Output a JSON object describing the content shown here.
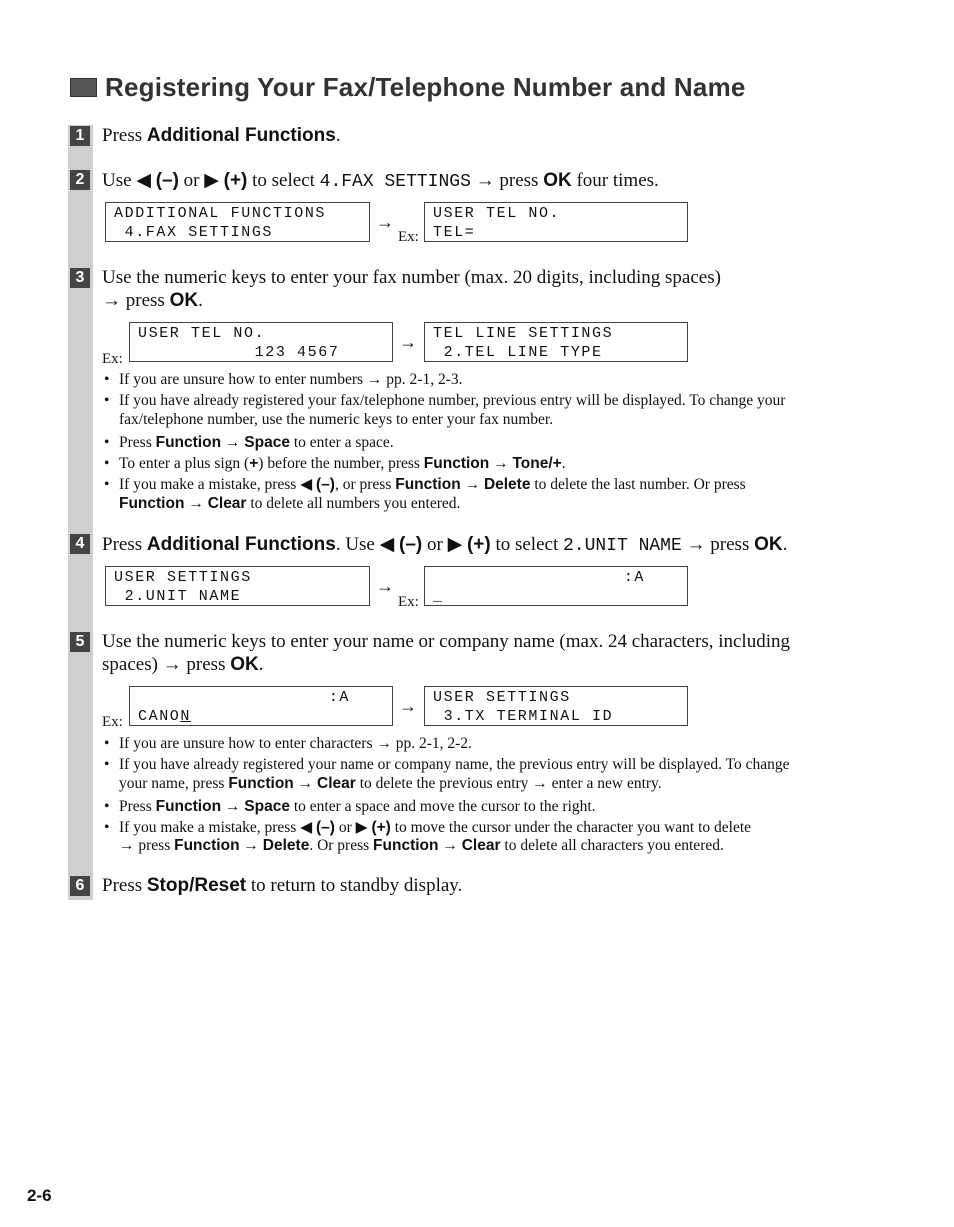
{
  "title": "Registering Your Fax/Telephone Number and Name",
  "page_number": "2-6",
  "symbols": {
    "arrow": "→",
    "left": "◀",
    "right": "▶",
    "ex": "Ex:"
  },
  "steps": [
    {
      "num": "1",
      "text_pre": "Press ",
      "bold": "Additional Functions",
      "text_post": "."
    },
    {
      "num": "2",
      "use": "Use",
      "minus": "(–)",
      "or": "or",
      "plus": "(+)",
      "to_select": "to select",
      "code": "4.FAX SETTINGS",
      "press": "press",
      "ok": "OK",
      "post": "four times.",
      "lcd_a": [
        "ADDITIONAL FUNCTIONS",
        " 4.FAX SETTINGS"
      ],
      "lcd_b": [
        "USER TEL NO.",
        "TEL="
      ]
    },
    {
      "num": "3",
      "line1": "Use the numeric keys to enter your fax number (max. 20 digits, including spaces)",
      "press": "press",
      "ok": "OK",
      "lcd_a": [
        "USER TEL NO.",
        "           123 4567"
      ],
      "lcd_b": [
        "TEL LINE SETTINGS",
        " 2.TEL LINE TYPE"
      ],
      "bullets": {
        "b1": "If you are unsure how to enter numbers → pp. 2-1, 2-3.",
        "b2a": "If you have already registered your fax/telephone number, previous entry will be displayed. To change your",
        "b2b": "fax/telephone number, use the numeric keys to enter your fax number.",
        "b3_pre": "Press ",
        "b3_k1": "Function",
        "b3_k2": "Space",
        "b3_post": " to enter a space.",
        "b4_pre": "To enter a plus sign (",
        "b4_plus": "+",
        "b4_mid": ") before the number, press ",
        "b4_k1": "Function",
        "b4_k2": "Tone/+",
        "b4_post": ".",
        "b5_pre": "If you make a mistake, press ",
        "b5_k0": "(–)",
        "b5_mid": ", or press ",
        "b5_k1": "Function",
        "b5_k2": "Delete",
        "b5_post": " to delete the last number. Or press",
        "b5c_k1": "Function",
        "b5c_k2": "Clear",
        "b5c_post": " to delete all numbers you entered."
      }
    },
    {
      "num": "4",
      "pre": "Press ",
      "bold": "Additional Functions",
      "use": ". Use",
      "minus": "(–)",
      "or": "or",
      "plus": "(+)",
      "to_select": "to select",
      "code": "2.UNIT NAME",
      "press": "press",
      "ok": "OK",
      "lcd_a": [
        "USER SETTINGS",
        " 2.UNIT NAME"
      ],
      "lcd_b": [
        "                  :A",
        "_"
      ]
    },
    {
      "num": "5",
      "line1": "Use the numeric keys to enter your name or company name (max. 24 characters, including",
      "line2": "spaces)",
      "press": "press",
      "ok": "OK",
      "lcd_a_top": "                  :A",
      "lcd_a_text": "CANO",
      "lcd_a_cursor": "N",
      "lcd_b": [
        "USER SETTINGS",
        " 3.TX TERMINAL ID"
      ],
      "bullets": {
        "b1": "If you are unsure how to enter characters → pp. 2-1, 2-2.",
        "b2a": "If you have already registered your name or company name, the previous entry will be displayed. To change",
        "b2b_pre": "your name, press ",
        "b2b_k1": "Function",
        "b2b_k2": "Clear",
        "b2b_post": " to delete the previous entry → enter a new entry.",
        "b3_pre": "Press ",
        "b3_k1": "Function",
        "b3_k2": "Space",
        "b3_post": " to enter a space and move the cursor to the right.",
        "b4_pre": "If you make a mistake, press ",
        "b4_k0": "(–)",
        "b4_or": " or ",
        "b4_k00": "(+)",
        "b4_post": " to move the cursor under the character you want to delete",
        "b4c_pre": "press ",
        "b4c_k1": "Function",
        "b4c_k2": "Delete",
        "b4c_mid": ". Or press ",
        "b4c_k3": "Function",
        "b4c_k4": "Clear",
        "b4c_post": " to delete all characters you entered."
      }
    },
    {
      "num": "6",
      "pre": "Press ",
      "bold": "Stop/Reset",
      "post": " to return to standby display."
    }
  ]
}
